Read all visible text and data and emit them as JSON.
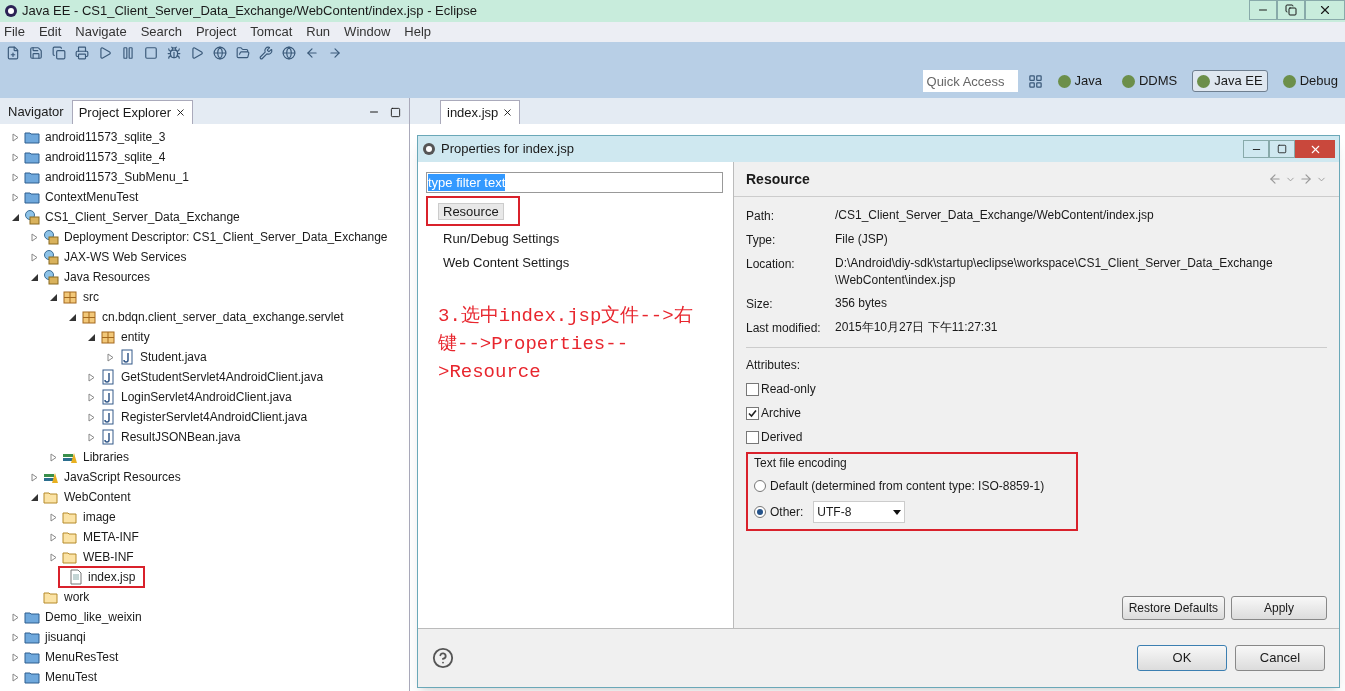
{
  "window": {
    "title": "Java EE - CS1_Client_Server_Data_Exchange/WebContent/index.jsp - Eclipse"
  },
  "menu": [
    "File",
    "Edit",
    "Navigate",
    "Search",
    "Project",
    "Tomcat",
    "Run",
    "Window",
    "Help"
  ],
  "quick_access": {
    "placeholder": "Quick Access"
  },
  "perspectives": [
    {
      "label": "Java",
      "selected": false
    },
    {
      "label": "DDMS",
      "selected": false
    },
    {
      "label": "Java EE",
      "selected": true
    },
    {
      "label": "Debug",
      "selected": false
    }
  ],
  "view_tabs": [
    {
      "label": "Navigator",
      "selected": false
    },
    {
      "label": "Project Explorer",
      "selected": true
    }
  ],
  "editor_tabs": [
    {
      "label": "index.jsp",
      "selected": true
    }
  ],
  "tree": [
    {
      "label": "android11573_sqlite_3",
      "kind": "project",
      "expandable": true,
      "expanded": false,
      "highlighted": false
    },
    {
      "label": "android11573_sqlite_4",
      "kind": "project",
      "expandable": true,
      "expanded": false,
      "highlighted": false
    },
    {
      "label": "android11573_SubMenu_1",
      "kind": "project",
      "expandable": true,
      "expanded": false,
      "highlighted": false
    },
    {
      "label": "ContextMenuTest",
      "kind": "project",
      "expandable": true,
      "expanded": false,
      "highlighted": false
    },
    {
      "label": "CS1_Client_Server_Data_Exchange",
      "kind": "web-project",
      "expandable": true,
      "expanded": true,
      "highlighted": false,
      "children": [
        {
          "label": "Deployment Descriptor: CS1_Client_Server_Data_Exchange",
          "kind": "descriptor",
          "expandable": true,
          "expanded": false,
          "highlighted": false
        },
        {
          "label": "JAX-WS Web Services",
          "kind": "services",
          "expandable": true,
          "expanded": false,
          "highlighted": false
        },
        {
          "label": "Java Resources",
          "kind": "resources",
          "expandable": true,
          "expanded": true,
          "highlighted": false,
          "children": [
            {
              "label": "src",
              "kind": "source",
              "expandable": true,
              "expanded": true,
              "highlighted": false,
              "children": [
                {
                  "label": "cn.bdqn.client_server_data_exchange.servlet",
                  "kind": "package",
                  "expandable": true,
                  "expanded": true,
                  "highlighted": false,
                  "children": [
                    {
                      "label": "entity",
                      "kind": "package",
                      "expandable": true,
                      "expanded": true,
                      "highlighted": false,
                      "children": [
                        {
                          "label": "Student.java",
                          "kind": "java",
                          "expandable": true,
                          "expanded": false,
                          "highlighted": false
                        }
                      ]
                    },
                    {
                      "label": "GetStudentServlet4AndroidClient.java",
                      "kind": "java",
                      "expandable": true,
                      "expanded": false,
                      "highlighted": false
                    },
                    {
                      "label": "LoginServlet4AndroidClient.java",
                      "kind": "java",
                      "expandable": true,
                      "expanded": false,
                      "highlighted": false
                    },
                    {
                      "label": "RegisterServlet4AndroidClient.java",
                      "kind": "java",
                      "expandable": true,
                      "expanded": false,
                      "highlighted": false
                    },
                    {
                      "label": "ResultJSONBean.java",
                      "kind": "java",
                      "expandable": true,
                      "expanded": false,
                      "highlighted": false
                    }
                  ]
                }
              ]
            },
            {
              "label": "Libraries",
              "kind": "libraries",
              "expandable": true,
              "expanded": false,
              "highlighted": false
            }
          ]
        },
        {
          "label": "JavaScript Resources",
          "kind": "libraries",
          "expandable": true,
          "expanded": false,
          "highlighted": false
        },
        {
          "label": "WebContent",
          "kind": "folder",
          "expandable": true,
          "expanded": true,
          "highlighted": false,
          "children": [
            {
              "label": "image",
              "kind": "folder",
              "expandable": true,
              "expanded": false,
              "highlighted": false
            },
            {
              "label": "META-INF",
              "kind": "folder",
              "expandable": true,
              "expanded": false,
              "highlighted": false
            },
            {
              "label": "WEB-INF",
              "kind": "folder",
              "expandable": true,
              "expanded": false,
              "highlighted": false
            },
            {
              "label": "index.jsp",
              "kind": "file",
              "expandable": false,
              "highlighted": true
            }
          ]
        },
        {
          "label": "work",
          "kind": "folder",
          "expandable": false,
          "highlighted": false
        }
      ]
    },
    {
      "label": "Demo_like_weixin",
      "kind": "project",
      "expandable": true,
      "expanded": false,
      "highlighted": false
    },
    {
      "label": "jisuanqi",
      "kind": "project",
      "expandable": true,
      "expanded": false,
      "highlighted": false
    },
    {
      "label": "MenuResTest",
      "kind": "project",
      "expandable": true,
      "expanded": false,
      "highlighted": false
    },
    {
      "label": "MenuTest",
      "kind": "project",
      "expandable": true,
      "expanded": false,
      "highlighted": false
    }
  ],
  "dialog": {
    "title": "Properties for index.jsp",
    "filter": {
      "value": "type filter text"
    },
    "pages": [
      {
        "label": "Resource",
        "selected": true,
        "highlighted": true
      },
      {
        "label": "Run/Debug Settings",
        "selected": false,
        "highlighted": false
      },
      {
        "label": "Web Content Settings",
        "selected": false,
        "highlighted": false
      }
    ],
    "annotation": "3.选中index.jsp文件-->右键-->Properties-->Resource",
    "heading": "Resource",
    "properties": [
      {
        "label": "Path:",
        "value": "/CS1_Client_Server_Data_Exchange/WebContent/index.jsp"
      },
      {
        "label": "Type:",
        "value": "File  (JSP)"
      },
      {
        "label": "Location:",
        "value": "D:\\Android\\diy-sdk\\startup\\eclipse\\workspace\\CS1_Client_Server_Data_Exchange \\WebContent\\index.jsp"
      },
      {
        "label": "Size:",
        "value": "356  bytes"
      },
      {
        "label": "Last modified:",
        "value": "2015年10月27日 下午11:27:31"
      }
    ],
    "attributes_label": "Attributes:",
    "attributes": [
      {
        "label": "Read-only",
        "checked": false
      },
      {
        "label": "Archive",
        "checked": true
      },
      {
        "label": "Derived",
        "checked": false
      }
    ],
    "encoding": {
      "title": "Text file encoding",
      "highlighted": true,
      "options": [
        {
          "label": "Default (determined from content type: ISO-8859-1)",
          "selected": false
        },
        {
          "label": "Other:",
          "selected": true
        }
      ],
      "value": "UTF-8"
    },
    "page_buttons": [
      "Restore Defaults",
      "Apply"
    ],
    "buttons": [
      "OK",
      "Cancel"
    ]
  }
}
